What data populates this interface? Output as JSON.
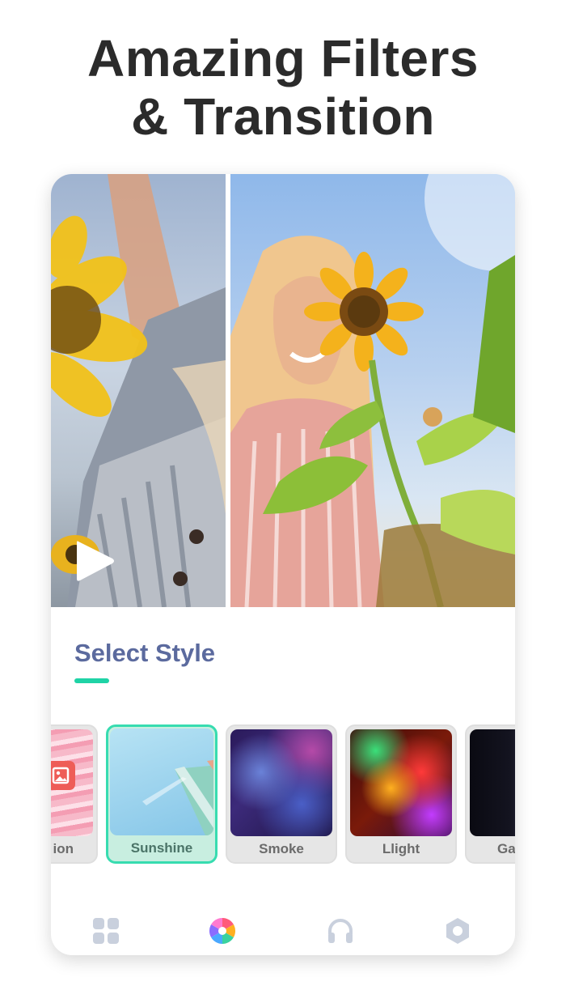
{
  "headline": {
    "line1": "Amazing Filters",
    "line2": "& Transition"
  },
  "preview": {
    "play_icon": "play-icon"
  },
  "section": {
    "title": "Select Style"
  },
  "styles": [
    {
      "label": "ion",
      "icon": "image-icon"
    },
    {
      "label": "Sunshine",
      "selected": true
    },
    {
      "label": "Smoke"
    },
    {
      "label": "Llight"
    },
    {
      "label": "Ga"
    }
  ],
  "nav": {
    "items": [
      {
        "icon": "grid-icon"
      },
      {
        "icon": "filter-wheel-icon",
        "active": true
      },
      {
        "icon": "headphones-icon"
      },
      {
        "icon": "hexagon-settings-icon"
      }
    ]
  },
  "colors": {
    "accent": "#1fd3a6",
    "title": "#5b6a9e",
    "icon_inactive": "#c9d0dd"
  }
}
